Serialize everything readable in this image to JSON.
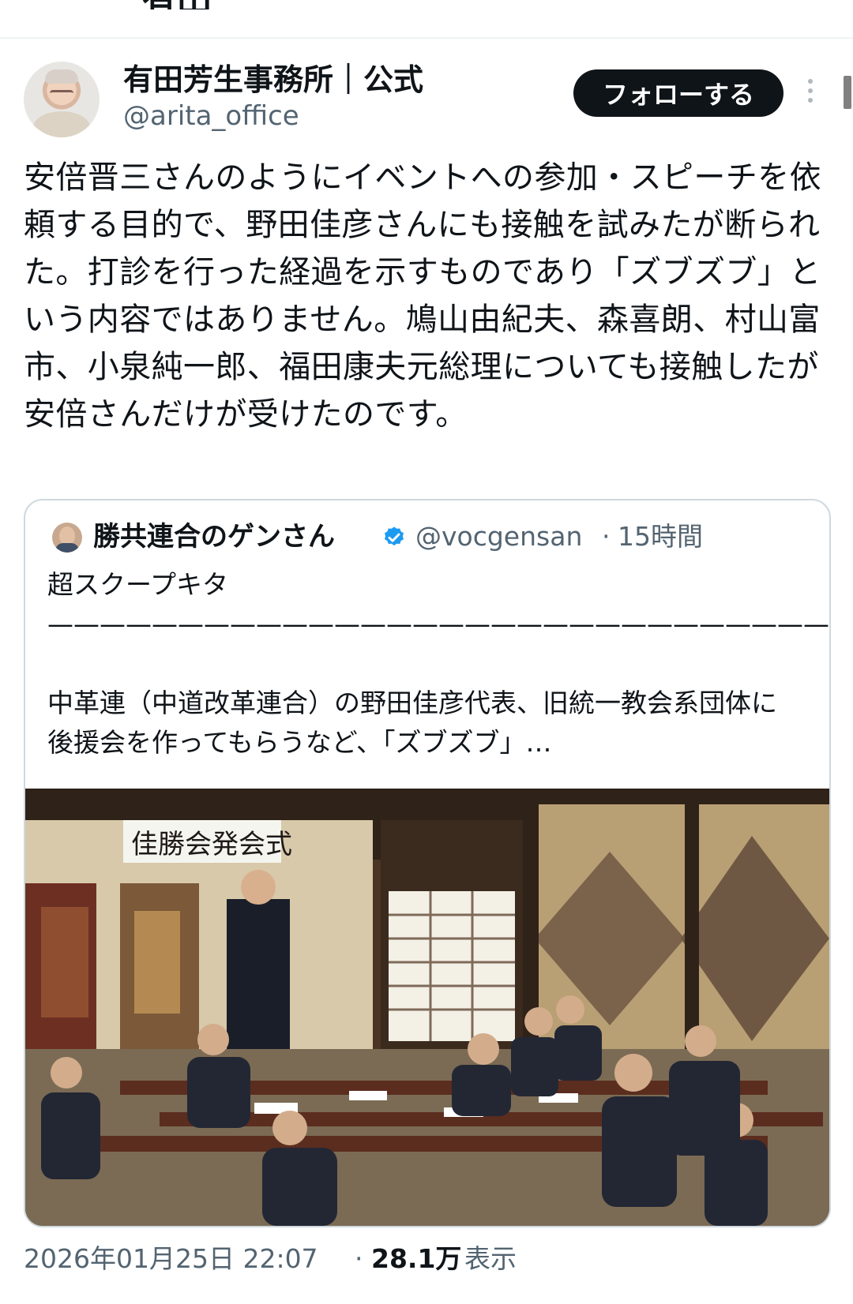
{
  "header": {
    "fragment": "有田芳生"
  },
  "post": {
    "author_name": "有田芳生事務所｜公式",
    "author_handle": "@arita_office",
    "follow_label": "フォローする",
    "text": "安倍晋三さんのようにイベントへの参加・スピーチを依頼する目的で、野田佳彦さんにも接触を試みたが断られた。打診を行った経過を示すものであり「ズブズブ」という内容ではありません。鳩山由紀夫、森喜朗、村山富市、小泉純一郎、福田康夫元総理についても接触したが安倍さんだけが受けたのです。",
    "timestamp": "2026年01月25日 22:07",
    "views_count": "28.1万",
    "views_label": "表示"
  },
  "quote": {
    "author_name": "勝共連合のゲンさん",
    "author_handle": "@vocgensan",
    "separator": "·",
    "time": "15時間",
    "text": "超スクープキタ——————————————————————————————!!\n\n中革連（中道改革連合）の野田佳彦代表、旧統一教会系団体に後援会を作ってもらうなど、「ズブズブ」…",
    "photo_banner": "佳勝会発会式"
  },
  "icons": {
    "verified": "verified-badge-icon",
    "more": "more-vertical-icon"
  },
  "colors": {
    "primary_text": "#0f1419",
    "secondary_text": "#536471",
    "border": "#cfd9de",
    "verified": "#1d9bf0",
    "button": "#0f1419"
  }
}
